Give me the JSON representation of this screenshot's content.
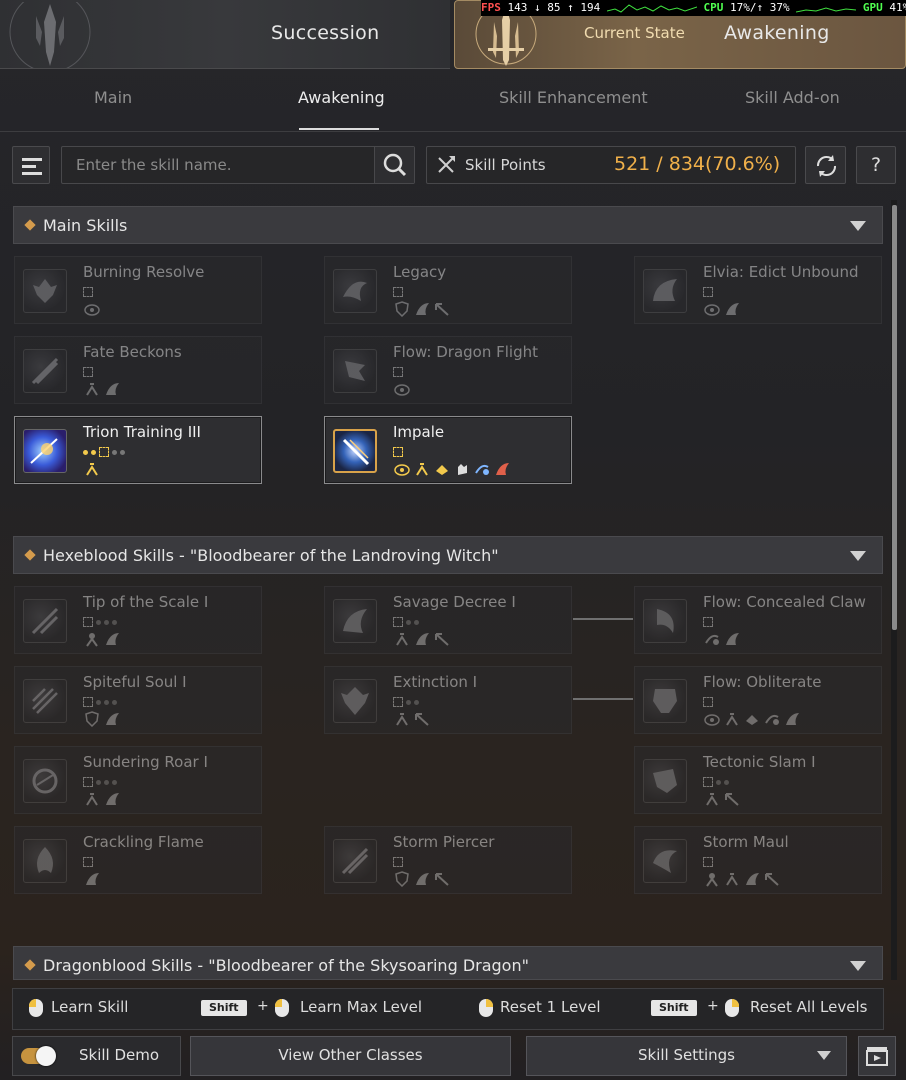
{
  "header": {
    "tab_succession": "Succession",
    "tab_current_state": "Current State",
    "tab_awakening": "Awakening"
  },
  "perf_overlay": {
    "fps_label": "FPS",
    "fps_value": "143 ↓ 85 ↑ 194",
    "cpu_label": "CPU",
    "cpu_value": "17%/↑ 37%",
    "gpu_label": "GPU",
    "gpu_value": "41%"
  },
  "subtabs": [
    "Main",
    "Awakening",
    "Skill Enhancement",
    "Skill Add-on"
  ],
  "active_subtab": "Awakening",
  "toolbar": {
    "search_placeholder": "Enter the skill name.",
    "skill_points_label": "Skill Points",
    "skill_points_value": "521 / 834(70.6%)",
    "help_label": "?"
  },
  "sections": {
    "main": {
      "title": "Main Skills",
      "skills": [
        {
          "name": "Burning Resolve",
          "learned": false
        },
        {
          "name": "Legacy",
          "learned": false
        },
        {
          "name": "Elvia: Edict Unbound",
          "learned": false
        },
        {
          "name": "Fate Beckons",
          "learned": false
        },
        {
          "name": "Flow: Dragon Flight",
          "learned": false
        },
        {
          "name": "Trion Training III",
          "learned": true
        },
        {
          "name": "Impale",
          "learned": true
        }
      ]
    },
    "hexeblood": {
      "title": "Hexeblood Skills - \"Bloodbearer of the Landroving Witch\"",
      "skills": [
        {
          "name": "Tip of the Scale I"
        },
        {
          "name": "Savage Decree I"
        },
        {
          "name": "Flow: Concealed Claw"
        },
        {
          "name": "Spiteful Soul I"
        },
        {
          "name": "Extinction I"
        },
        {
          "name": "Flow: Obliterate"
        },
        {
          "name": "Sundering Roar I"
        },
        {
          "name": "Tectonic Slam I"
        },
        {
          "name": "Crackling Flame"
        },
        {
          "name": "Storm Piercer"
        },
        {
          "name": "Storm Maul"
        }
      ]
    },
    "dragonblood": {
      "title": "Dragonblood Skills - \"Bloodbearer of the Skysoaring Dragon\""
    }
  },
  "hints": {
    "learn_skill": "Learn Skill",
    "shift_key": "Shift",
    "plus": "+",
    "learn_max": "Learn Max Level",
    "reset_one": "Reset 1 Level",
    "reset_all": "Reset All Levels"
  },
  "bottom": {
    "skill_demo_label": "Skill Demo",
    "skill_demo_on": true,
    "view_other_classes": "View Other Classes",
    "skill_settings": "Skill Settings"
  },
  "colors": {
    "accent_gold": "#f0b04a",
    "toggle_on": "#c6933f",
    "section_diamond": "#d49b4c"
  }
}
